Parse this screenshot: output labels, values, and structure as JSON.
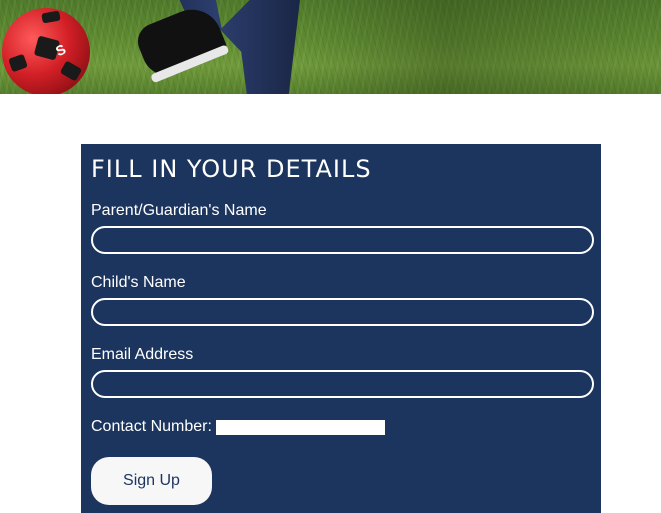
{
  "form": {
    "title": "FILL IN YOUR DETAILS",
    "fields": [
      {
        "label": "Parent/Guardian's Name",
        "value": ""
      },
      {
        "label": "Child's Name",
        "value": ""
      },
      {
        "label": "Email Address",
        "value": ""
      }
    ],
    "contact": {
      "label": "Contact Number:",
      "value": ""
    },
    "submit_label": "Sign Up"
  },
  "colors": {
    "panel_background": "#1c355e",
    "text": "#ffffff",
    "button_background": "#f7f7f7"
  },
  "hero": {
    "image_subject": "child kicking red football on grass",
    "icons": [
      "football-icon"
    ]
  }
}
